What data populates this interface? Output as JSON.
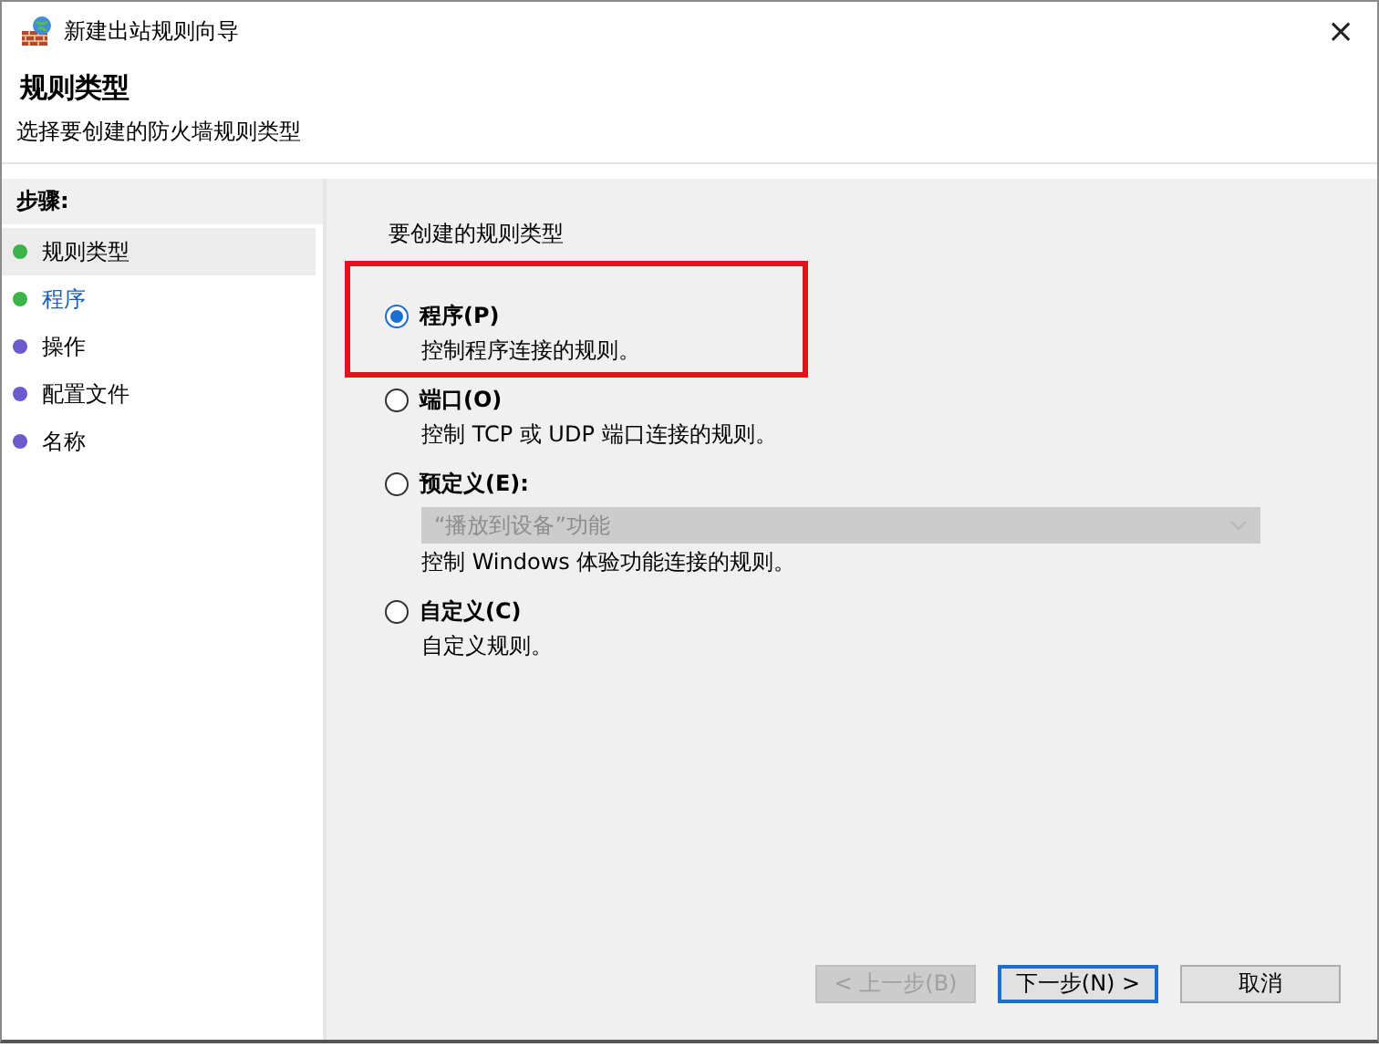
{
  "window": {
    "title": "新建出站规则向导",
    "close": "×"
  },
  "header": {
    "title": "规则类型",
    "subtitle": "选择要创建的防火墙规则类型"
  },
  "steps": {
    "title": "步骤:",
    "items": [
      {
        "label": "规则类型",
        "color": "#3cb34a",
        "current": false,
        "highlighted": true
      },
      {
        "label": "程序",
        "color": "#3cb34a",
        "current": true,
        "highlighted": false
      },
      {
        "label": "操作",
        "color": "#6a5acd",
        "current": false,
        "highlighted": false
      },
      {
        "label": "配置文件",
        "color": "#6a5acd",
        "current": false,
        "highlighted": false
      },
      {
        "label": "名称",
        "color": "#6a5acd",
        "current": false,
        "highlighted": false
      }
    ]
  },
  "prompt": "要创建的规则类型",
  "options": [
    {
      "label": "程序(P)",
      "description": "控制程序连接的规则。",
      "selected": true,
      "annotated": true
    },
    {
      "label": "端口(O)",
      "description": "控制 TCP 或 UDP 端口连接的规则。",
      "selected": false,
      "annotated": false
    },
    {
      "label": "预定义(E):",
      "dropdown": {
        "value": "“播放到设备”功能",
        "disabled": true
      },
      "description": "控制 Windows 体验功能连接的规则。",
      "selected": false,
      "annotated": false
    },
    {
      "label": "自定义(C)",
      "description": "自定义规则。",
      "selected": false,
      "annotated": false
    }
  ],
  "buttons": [
    {
      "label": "< 上一步(B)",
      "disabled": true,
      "default": false
    },
    {
      "label": "下一步(N) >",
      "disabled": false,
      "default": true
    },
    {
      "label": "取消",
      "disabled": false,
      "default": false
    }
  ]
}
